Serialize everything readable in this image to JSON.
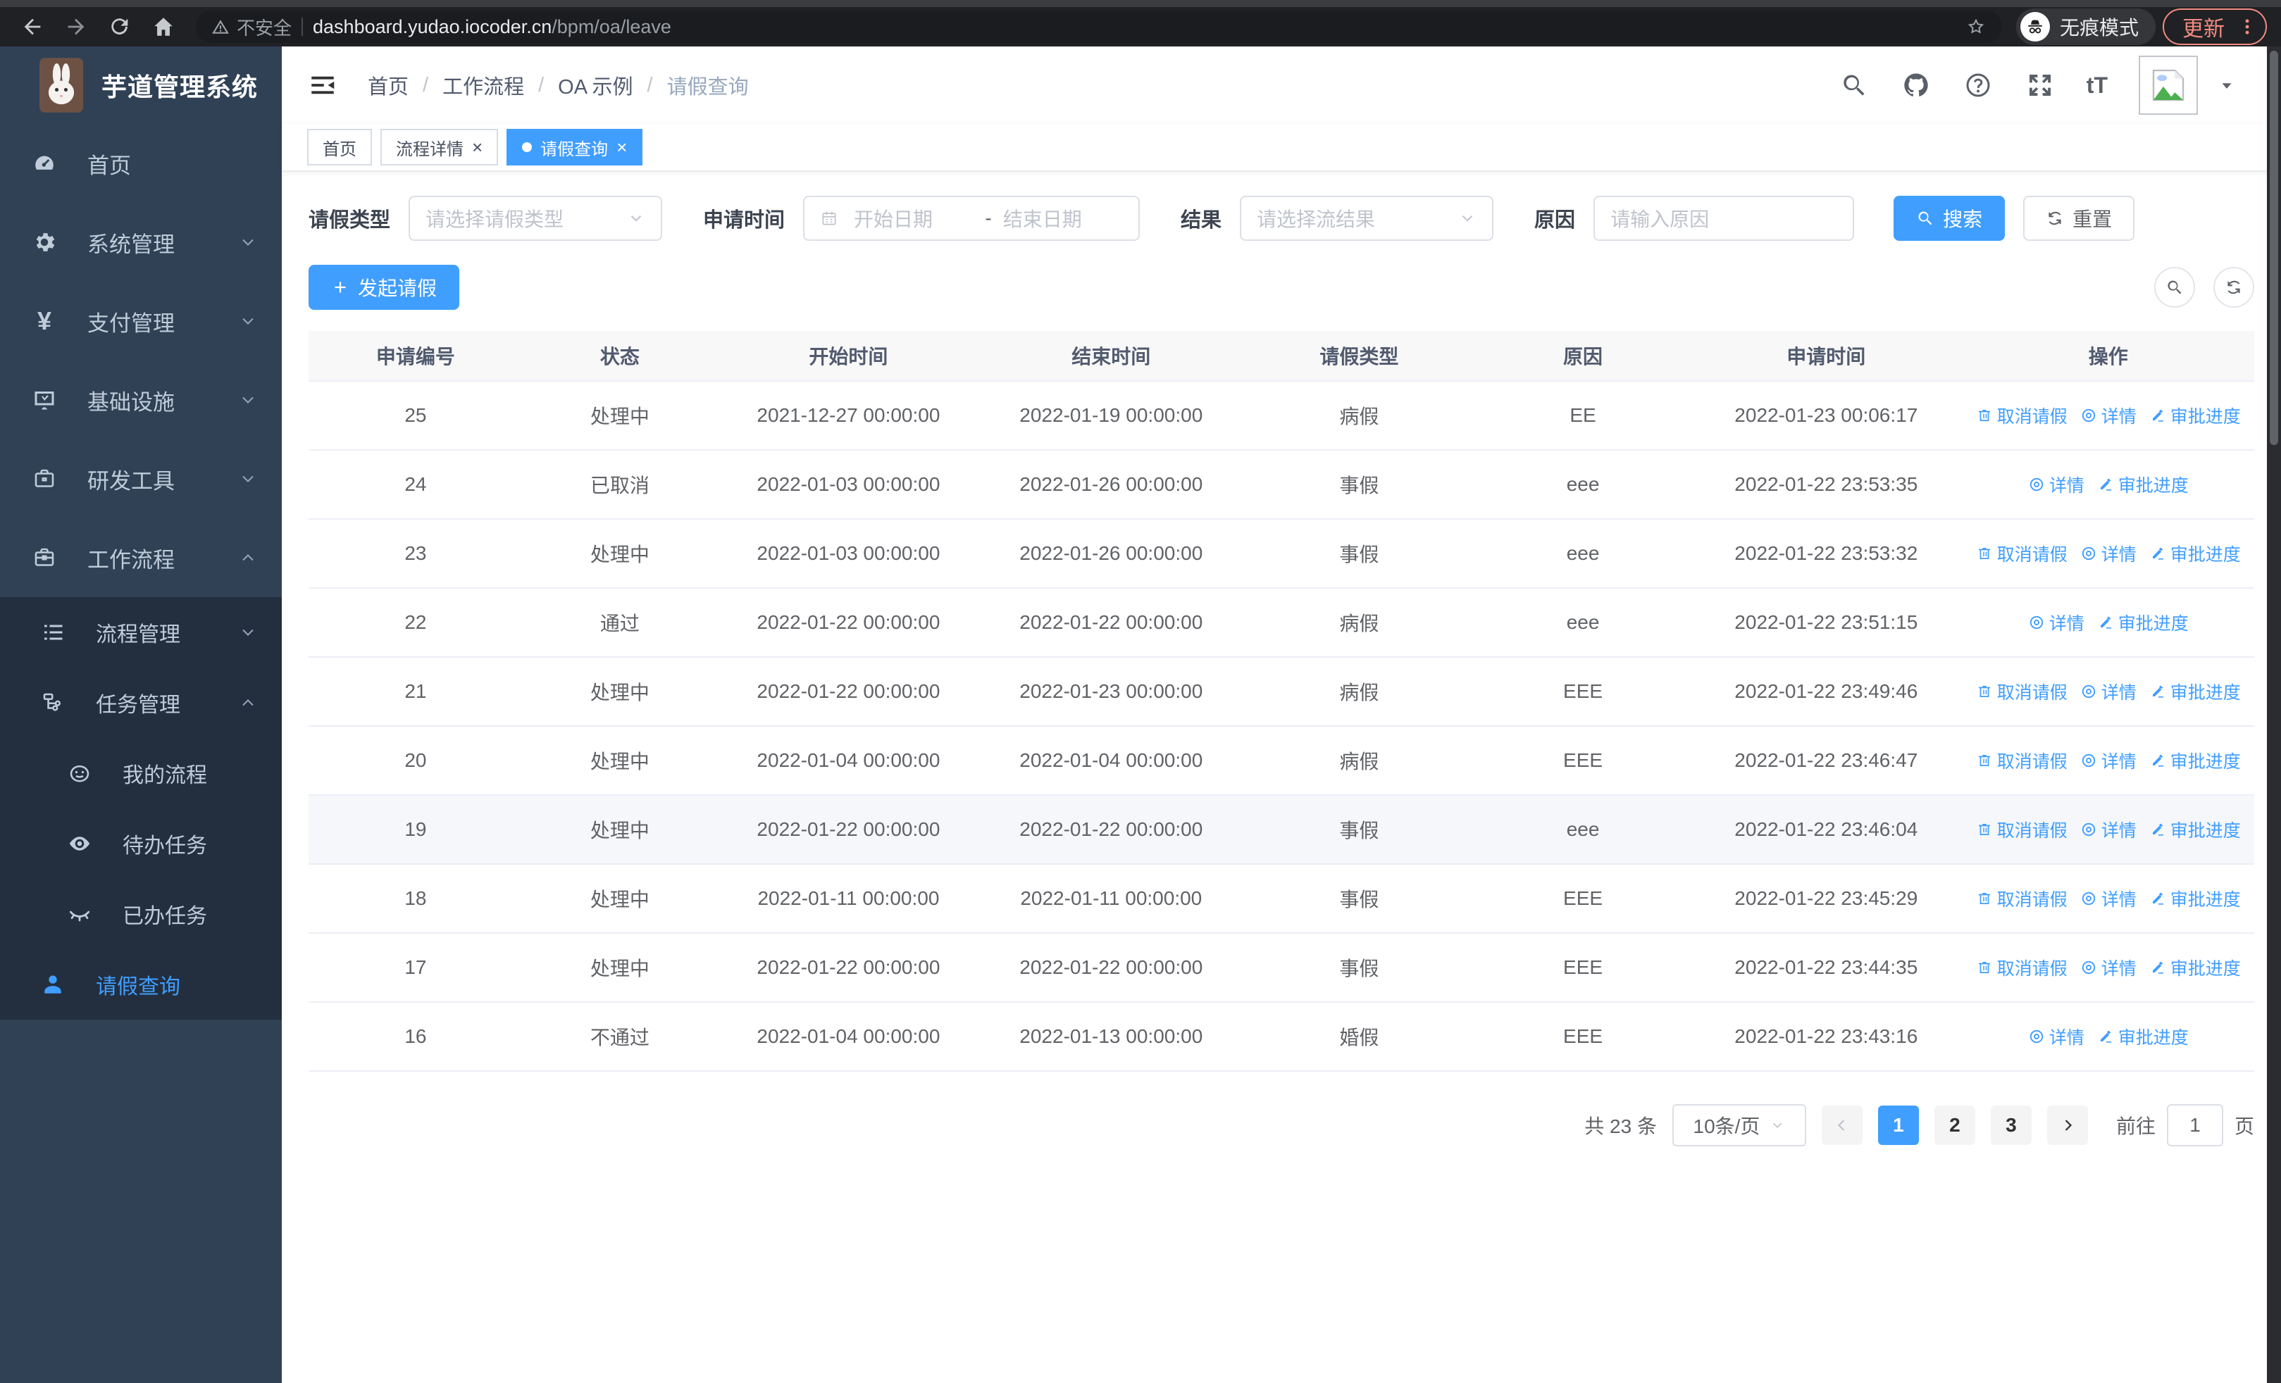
{
  "browser": {
    "security_label": "不安全",
    "url_host": "dashboard.yudao.iocoder.cn",
    "url_path": "/bpm/oa/leave",
    "incognito_label": "无痕模式",
    "update_label": "更新"
  },
  "header": {
    "logo_title": "芋道管理系统",
    "breadcrumb": [
      "首页",
      "工作流程",
      "OA 示例",
      "请假查询"
    ]
  },
  "tabs": [
    {
      "label": "首页",
      "closable": false,
      "active": false
    },
    {
      "label": "流程详情",
      "closable": true,
      "active": false
    },
    {
      "label": "请假查询",
      "closable": true,
      "active": true
    }
  ],
  "sidebar": {
    "items": [
      {
        "label": "首页",
        "icon": "dashboard-icon"
      },
      {
        "label": "系统管理",
        "icon": "gear-icon",
        "arrow": "down"
      },
      {
        "label": "支付管理",
        "icon": "yen-icon",
        "arrow": "down"
      },
      {
        "label": "基础设施",
        "icon": "monitor-icon",
        "arrow": "down"
      },
      {
        "label": "研发工具",
        "icon": "toolbox-icon",
        "arrow": "down"
      },
      {
        "label": "工作流程",
        "icon": "briefcase-icon",
        "arrow": "up",
        "expanded": true,
        "children": [
          {
            "label": "流程管理",
            "icon": "list-icon",
            "arrow": "down"
          },
          {
            "label": "任务管理",
            "icon": "workflow-icon",
            "arrow": "up",
            "expanded": true,
            "children": [
              {
                "label": "我的流程",
                "icon": "robot-icon"
              },
              {
                "label": "待办任务",
                "icon": "eye-icon"
              },
              {
                "label": "已办任务",
                "icon": "eye-closed-icon"
              }
            ]
          },
          {
            "label": "请假查询",
            "icon": "user-icon",
            "active": true
          }
        ]
      }
    ]
  },
  "filters": {
    "leave_type_label": "请假类型",
    "leave_type_placeholder": "请选择请假类型",
    "apply_time_label": "申请时间",
    "start_placeholder": "开始日期",
    "range_separator": "-",
    "end_placeholder": "结束日期",
    "result_label": "结果",
    "result_placeholder": "请选择流结果",
    "reason_label": "原因",
    "reason_placeholder": "请输入原因",
    "search_label": "搜索",
    "reset_label": "重置"
  },
  "toolbar": {
    "create_label": "发起请假"
  },
  "actions": {
    "cancel": {
      "label": "取消请假",
      "icon": "trash-icon"
    },
    "detail": {
      "label": "详情",
      "icon": "view-icon"
    },
    "progress": {
      "label": "审批进度",
      "icon": "edit-icon"
    }
  },
  "table": {
    "columns": [
      "申请编号",
      "状态",
      "开始时间",
      "结束时间",
      "请假类型",
      "原因",
      "申请时间",
      "操作"
    ],
    "rows": [
      {
        "id": "25",
        "status": "处理中",
        "start": "2021-12-27 00:00:00",
        "end": "2022-01-19 00:00:00",
        "type": "病假",
        "reason": "EE",
        "apply": "2022-01-23 00:06:17",
        "actions": [
          "cancel",
          "detail",
          "progress"
        ],
        "highlighted": false
      },
      {
        "id": "24",
        "status": "已取消",
        "start": "2022-01-03 00:00:00",
        "end": "2022-01-26 00:00:00",
        "type": "事假",
        "reason": "eee",
        "apply": "2022-01-22 23:53:35",
        "actions": [
          "detail",
          "progress"
        ],
        "highlighted": false
      },
      {
        "id": "23",
        "status": "处理中",
        "start": "2022-01-03 00:00:00",
        "end": "2022-01-26 00:00:00",
        "type": "事假",
        "reason": "eee",
        "apply": "2022-01-22 23:53:32",
        "actions": [
          "cancel",
          "detail",
          "progress"
        ],
        "highlighted": false
      },
      {
        "id": "22",
        "status": "通过",
        "start": "2022-01-22 00:00:00",
        "end": "2022-01-22 00:00:00",
        "type": "病假",
        "reason": "eee",
        "apply": "2022-01-22 23:51:15",
        "actions": [
          "detail",
          "progress"
        ],
        "highlighted": false
      },
      {
        "id": "21",
        "status": "处理中",
        "start": "2022-01-22 00:00:00",
        "end": "2022-01-23 00:00:00",
        "type": "病假",
        "reason": "EEE",
        "apply": "2022-01-22 23:49:46",
        "actions": [
          "cancel",
          "detail",
          "progress"
        ],
        "highlighted": false
      },
      {
        "id": "20",
        "status": "处理中",
        "start": "2022-01-04 00:00:00",
        "end": "2022-01-04 00:00:00",
        "type": "病假",
        "reason": "EEE",
        "apply": "2022-01-22 23:46:47",
        "actions": [
          "cancel",
          "detail",
          "progress"
        ],
        "highlighted": false
      },
      {
        "id": "19",
        "status": "处理中",
        "start": "2022-01-22 00:00:00",
        "end": "2022-01-22 00:00:00",
        "type": "事假",
        "reason": "eee",
        "apply": "2022-01-22 23:46:04",
        "actions": [
          "cancel",
          "detail",
          "progress"
        ],
        "highlighted": true
      },
      {
        "id": "18",
        "status": "处理中",
        "start": "2022-01-11 00:00:00",
        "end": "2022-01-11 00:00:00",
        "type": "事假",
        "reason": "EEE",
        "apply": "2022-01-22 23:45:29",
        "actions": [
          "cancel",
          "detail",
          "progress"
        ],
        "highlighted": false
      },
      {
        "id": "17",
        "status": "处理中",
        "start": "2022-01-22 00:00:00",
        "end": "2022-01-22 00:00:00",
        "type": "事假",
        "reason": "EEE",
        "apply": "2022-01-22 23:44:35",
        "actions": [
          "cancel",
          "detail",
          "progress"
        ],
        "highlighted": false
      },
      {
        "id": "16",
        "status": "不通过",
        "start": "2022-01-04 00:00:00",
        "end": "2022-01-13 00:00:00",
        "type": "婚假",
        "reason": "EEE",
        "apply": "2022-01-22 23:43:16",
        "actions": [
          "detail",
          "progress"
        ],
        "highlighted": false
      }
    ]
  },
  "pagination": {
    "total_label": "共 23 条",
    "page_size_label": "10条/页",
    "pages": [
      "1",
      "2",
      "3"
    ],
    "active_page": "1",
    "goto_label": "前往",
    "goto_value": "1",
    "unit_label": "页"
  },
  "colors": {
    "primary": "#409eff",
    "sidebar_bg": "#304156",
    "submenu_bg": "#232f3f"
  }
}
